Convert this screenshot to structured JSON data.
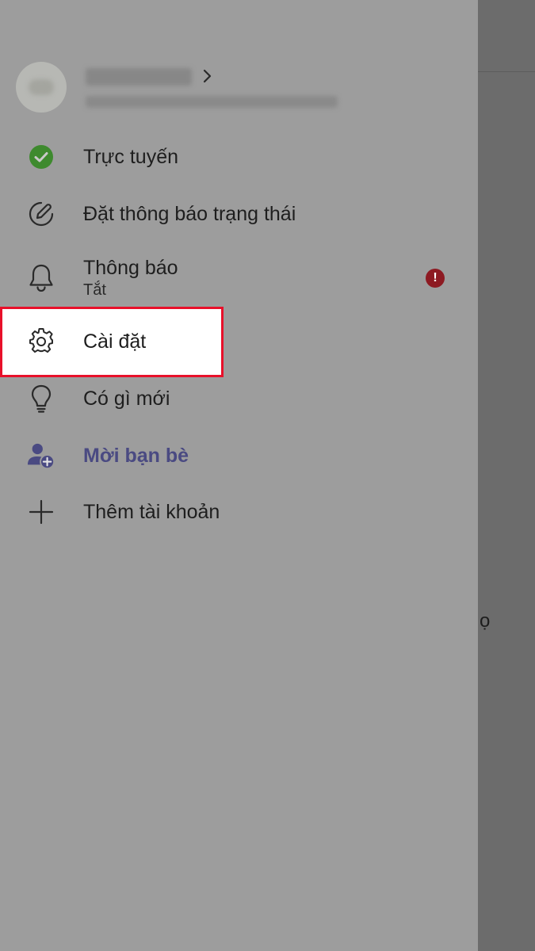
{
  "menu": {
    "online": "Trực tuyến",
    "set_status": "Đặt thông báo trạng thái",
    "notifications": "Thông báo",
    "notifications_sub": "Tắt",
    "notifications_badge": "!",
    "settings": "Cài đặt",
    "whats_new": "Có gì mới",
    "invite_friends": "Mời bạn bè",
    "add_account": "Thêm tài khoản"
  },
  "background": {
    "partial_text": "ọ"
  },
  "colors": {
    "status_online": "#3e8a2e",
    "invite_accent": "#4a4a82",
    "badge": "#8d1a22",
    "highlight_border": "#e8102a"
  },
  "icons": [
    "check-circle-icon",
    "edit-status-icon",
    "bell-icon",
    "gear-icon",
    "lightbulb-icon",
    "person-add-icon",
    "plus-icon",
    "chevron-right-icon"
  ]
}
